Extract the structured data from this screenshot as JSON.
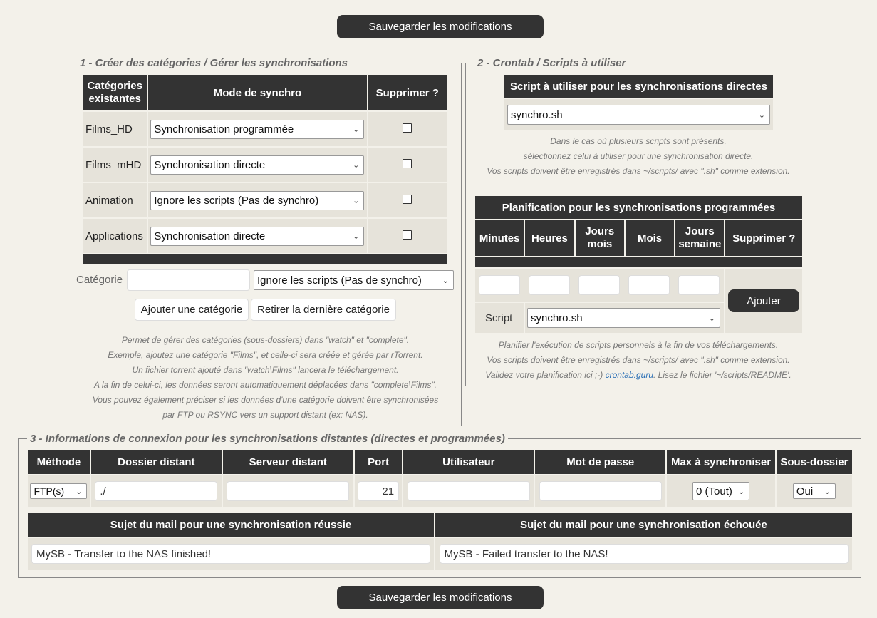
{
  "save_button_label": "Sauvegarder les modifications",
  "section1": {
    "legend": "1 - Créer des catégories / Gérer les synchronisations",
    "headers": [
      "Catégories existantes",
      "Mode de synchro",
      "Supprimer ?"
    ],
    "rows": [
      {
        "category": "Films_HD",
        "mode": "Synchronisation programmée"
      },
      {
        "category": "Films_mHD",
        "mode": "Synchronisation directe"
      },
      {
        "category": "Animation",
        "mode": "Ignore les scripts (Pas de synchro)"
      },
      {
        "category": "Applications",
        "mode": "Synchronisation directe"
      }
    ],
    "new_category_label": "Catégorie",
    "new_category_value": "",
    "new_mode": "Ignore les scripts (Pas de synchro)",
    "add_button": "Ajouter une catégorie",
    "remove_button": "Retirer la dernière catégorie",
    "help_lines": [
      "Permet de gérer des catégories (sous-dossiers) dans \"watch\" et \"complete\".",
      "Exemple, ajoutez une catégorie \"Films\", et celle-ci sera créée et gérée par rTorrent.",
      "Un fichier torrent ajouté dans \"watch\\Films\" lancera le téléchargement.",
      "A la fin de celui-ci, les données seront automatiquement déplacées dans \"complete\\Films\".",
      "Vous pouvez également préciser si les données d'une catégorie doivent être synchronisées",
      "par FTP ou RSYNC vers un support distant (ex: NAS)."
    ]
  },
  "section2": {
    "legend": "2 - Crontab / Scripts à utiliser",
    "script_header": "Script à utiliser pour les synchronisations directes",
    "script_value": "synchro.sh",
    "help_lines": [
      "Dans le cas où plusieurs scripts sont présents,",
      "sélectionnez celui à utiliser pour une synchronisation directe.",
      "Vos scripts doivent être enregistrés dans ~/scripts/ avec \".sh\" comme extension."
    ],
    "planning_header": "Planification pour les synchronisations programmées",
    "columns": [
      "Minutes",
      "Heures",
      "Jours mois",
      "Mois",
      "Jours semaine",
      "Supprimer ?"
    ],
    "script_label": "Script",
    "planning_script": "synchro.sh",
    "add_button": "Ajouter",
    "help2_line1": "Planifier l'exécution de scripts personnels à la fin de vos téléchargements.",
    "help2_line2": "Vos scripts doivent être enregistrés dans ~/scripts/ avec \".sh\" comme extension.",
    "help2_prefix": "Validez votre planification ici ;-) ",
    "help2_link": "crontab.guru",
    "help2_suffix": ". Lisez le fichier '~/scripts/README'."
  },
  "section3": {
    "legend": "3 - Informations de connexion pour les synchronisations distantes (directes et programmées)",
    "headers": [
      "Méthode",
      "Dossier distant",
      "Serveur distant",
      "Port",
      "Utilisateur",
      "Mot de passe",
      "Max à synchroniser",
      "Sous-dossier"
    ],
    "method": "FTP(s)",
    "remote_folder": "./",
    "remote_server": "",
    "port": "21",
    "user": "",
    "password": "",
    "max_sync": "0 (Tout)",
    "subfolder": "Oui",
    "mail_success_header": "Sujet du mail pour une synchronisation réussie",
    "mail_failure_header": "Sujet du mail pour une synchronisation échouée",
    "mail_success": "MySB - Transfer to the NAS finished!",
    "mail_failure": "MySB - Failed transfer to the NAS!"
  }
}
